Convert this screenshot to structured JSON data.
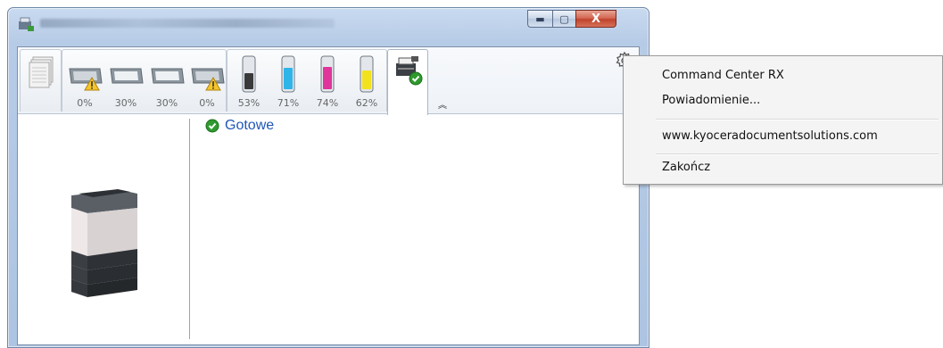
{
  "window": {
    "title": "",
    "controls": {
      "minimize": "▬",
      "maximize": "▢",
      "close": "X"
    }
  },
  "toolbar": {
    "trays": [
      {
        "name": "tray-1",
        "percent": "0%",
        "warning": true
      },
      {
        "name": "tray-2",
        "percent": "30%",
        "warning": false
      },
      {
        "name": "tray-3",
        "percent": "30%",
        "warning": false
      },
      {
        "name": "tray-4",
        "percent": "0%",
        "warning": true
      }
    ],
    "toners": [
      {
        "name": "black",
        "percent": "53%",
        "level": 0.53,
        "color": "#3a3a3a"
      },
      {
        "name": "cyan",
        "percent": "71%",
        "level": 0.71,
        "color": "#2fb4e8"
      },
      {
        "name": "magenta",
        "percent": "74%",
        "level": 0.74,
        "color": "#e0359a"
      },
      {
        "name": "yellow",
        "percent": "62%",
        "level": 0.62,
        "color": "#f2e21e"
      }
    ],
    "collapse_glyph": "︽"
  },
  "status": {
    "text": "Gotowe",
    "icon": "check-icon",
    "color": "#1f57b8"
  },
  "menu": {
    "items": [
      "Command Center RX",
      "Powiadomienie...",
      "www.kyoceradocumentsolutions.com",
      "Zakończ"
    ]
  }
}
